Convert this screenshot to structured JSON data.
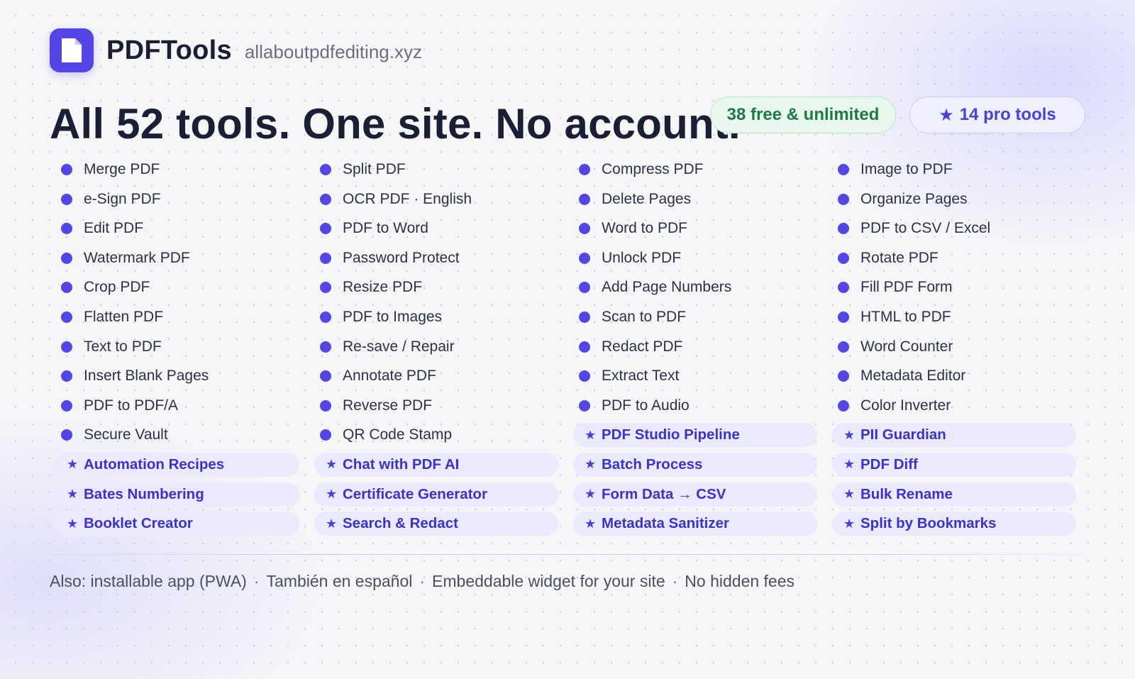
{
  "brand": {
    "name": "PDFTools",
    "domain": "allaboutpdfediting.xyz",
    "logo_icon": "document-icon",
    "accent": "#5345e6"
  },
  "headline": "All 52 tools. One site. No account.",
  "badges": {
    "free": "38 free & unlimited",
    "pro_star": "★",
    "pro": "14 pro tools"
  },
  "columns": [
    {
      "tools": [
        "Merge PDF",
        "e-Sign PDF",
        "Edit PDF",
        "Watermark PDF",
        "Crop PDF",
        "Flatten PDF",
        "Text to PDF",
        "Insert Blank Pages",
        "PDF to PDF/A",
        "Secure Vault"
      ],
      "pro_tools": [
        "Automation Recipes",
        "Bates Numbering",
        "Booklet Creator"
      ]
    },
    {
      "tools": [
        "Split PDF",
        "OCR PDF · English",
        "PDF to Word",
        "Password Protect",
        "Resize PDF",
        "PDF to Images",
        "Re-save / Repair",
        "Annotate PDF",
        "Reverse PDF",
        "QR Code Stamp"
      ],
      "pro_tools": [
        "Chat with PDF AI",
        "Certificate Generator",
        "Search & Redact"
      ]
    },
    {
      "tools": [
        "Compress PDF",
        "Delete Pages",
        "Word to PDF",
        "Unlock PDF",
        "Add Page Numbers",
        "Scan to PDF",
        "Redact PDF",
        "Extract Text",
        "PDF to Audio"
      ],
      "pro_tools": [
        "PDF Studio Pipeline",
        "Batch Process",
        "Form Data → CSV",
        "Metadata Sanitizer"
      ]
    },
    {
      "tools": [
        "Image to PDF",
        "Organize Pages",
        "PDF to CSV / Excel",
        "Rotate PDF",
        "Fill PDF Form",
        "HTML to PDF",
        "Word Counter",
        "Metadata Editor",
        "Color Inverter"
      ],
      "pro_tools": [
        "PII Guardian",
        "PDF Diff",
        "Bulk Rename",
        "Split by Bookmarks"
      ]
    }
  ],
  "pro_star": "★",
  "footer": {
    "items": [
      "Also: installable app (PWA)",
      "También en español",
      "Embeddable widget for your site",
      "No hidden fees"
    ],
    "separator": "·"
  }
}
